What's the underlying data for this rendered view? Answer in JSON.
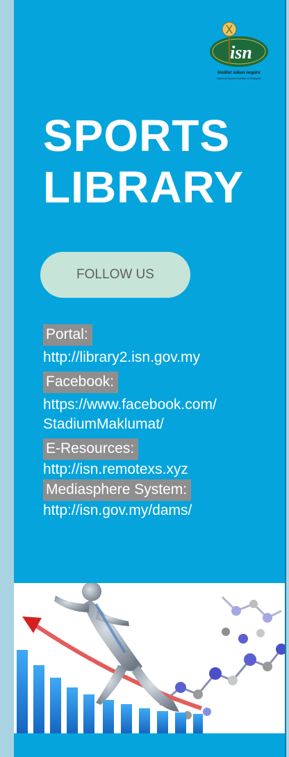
{
  "logo": {
    "mark": "isn",
    "tagline": "institut sukan negara",
    "subtagline": "National Sports Institute of Malaysia"
  },
  "title": {
    "line1": "SPORTS",
    "line2": "LIBRARY"
  },
  "follow_button": {
    "label": "FOLLOW US"
  },
  "links": [
    {
      "label": "Portal:",
      "url_lines": [
        "http://library2.isn.gov.my"
      ]
    },
    {
      "label": "Facebook:",
      "url_lines": [
        "https://www.facebook.com/",
        "StadiumMaklumat/"
      ]
    },
    {
      "label": "E-Resources:",
      "url_lines": [
        "http://isn.remotexs.xyz"
      ]
    },
    {
      "label": "Mediasphere System:",
      "url_lines": [
        "http://isn.gov.my/dams/"
      ]
    }
  ],
  "colors": {
    "banner": "#06a4dc",
    "page_bg": "#a9d3e3",
    "button": "#c7e4d8",
    "label_bg": "#8e8e8e",
    "logo_green": "#1d6b3a"
  },
  "icons": [
    "isn-logo-icon",
    "sprinter-illustration",
    "molecule-illustration",
    "bar-growth-illustration",
    "trend-arrow-icon"
  ]
}
